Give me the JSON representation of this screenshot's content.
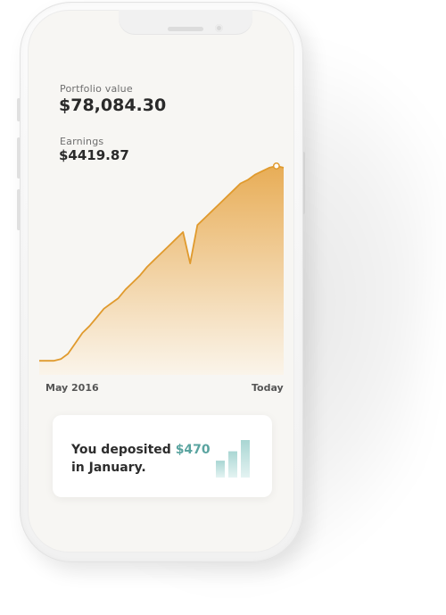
{
  "portfolio": {
    "label": "Portfolio value",
    "value": "$78,084.30"
  },
  "earnings": {
    "label": "Earnings",
    "value": "$4419.87"
  },
  "chart": {
    "start_label": "May 2016",
    "end_label": "Today"
  },
  "chart_data": {
    "type": "area",
    "x": [
      "May 2016",
      "Today"
    ],
    "series": [
      {
        "values": [
          4,
          4,
          4,
          5,
          8,
          14,
          20,
          24,
          29,
          34,
          37,
          40,
          45,
          49,
          53,
          58,
          62,
          66,
          70,
          74,
          78,
          60,
          82,
          86,
          90,
          94,
          98,
          102,
          106,
          108,
          111,
          113,
          115,
          116,
          115
        ]
      }
    ],
    "colors": {
      "line": "#e09a2d",
      "area_top": "#e7a94e",
      "area_bottom": "#fbf4e9"
    }
  },
  "deposit_card": {
    "prefix": "You deposited ",
    "amount": "$470",
    "suffix": "in January.",
    "icon": "bar-chart-icon",
    "icon_values": [
      0.45,
      0.7,
      1.0
    ],
    "accent_color": "#5aa4a0"
  }
}
